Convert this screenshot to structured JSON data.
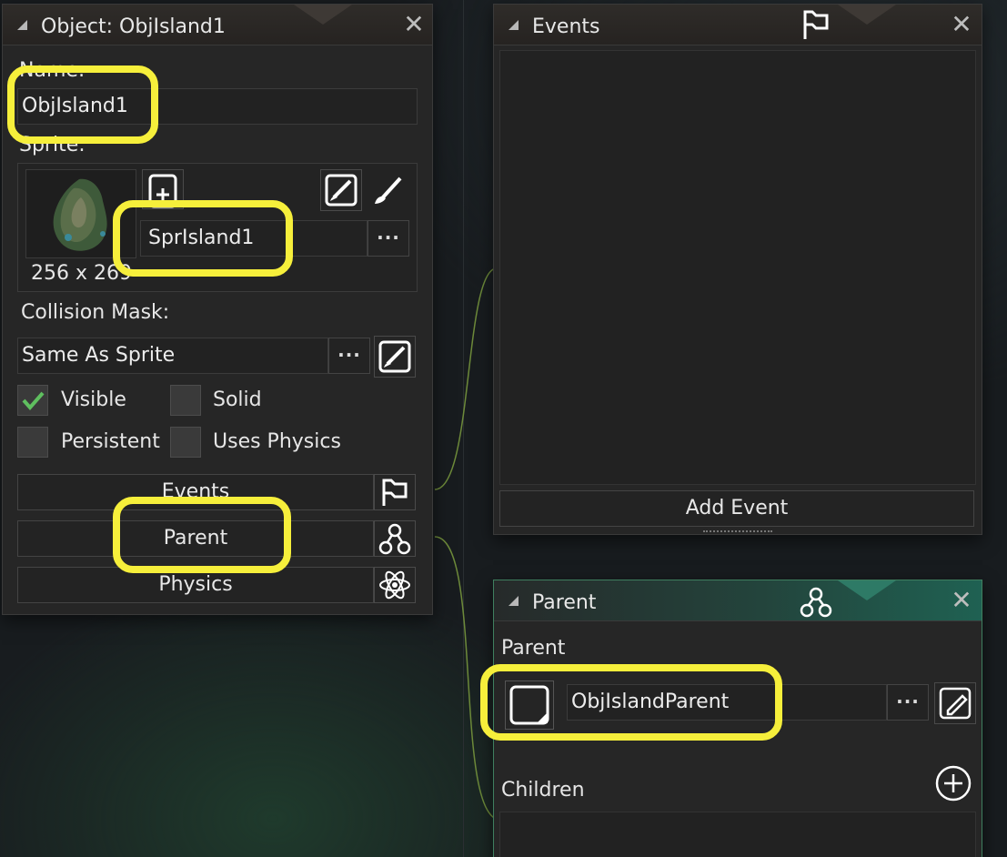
{
  "object_window": {
    "title": "Object: ObjIsland1",
    "name_label": "Name:",
    "name_value": "ObjIsland1",
    "sprite_label": "Sprite:",
    "sprite_name": "SprIsland1",
    "sprite_size": "256 x 269",
    "collision_label": "Collision Mask:",
    "collision_value": "Same As Sprite",
    "checkboxes": {
      "visible": "Visible",
      "solid": "Solid",
      "persistent": "Persistent",
      "uses_physics": "Uses Physics"
    },
    "buttons": {
      "events": "Events",
      "parent": "Parent",
      "physics": "Physics"
    },
    "ellipsis": "···"
  },
  "events_window": {
    "title": "Events",
    "add_event": "Add Event"
  },
  "parent_window": {
    "title": "Parent",
    "parent_label": "Parent",
    "parent_value": "ObjIslandParent",
    "children_label": "Children",
    "ellipsis": "···"
  },
  "colors": {
    "highlight": "#f6ef3b",
    "checkmark": "#5fbf5f",
    "teal_accent": "#1f6152"
  },
  "icons": [
    "close-icon",
    "flag-icon",
    "parent-tree-icon",
    "atom-icon",
    "paint-brush-icon",
    "new-sprite-icon",
    "edit-pencil-icon",
    "add-circle-icon",
    "checkmark-icon"
  ]
}
